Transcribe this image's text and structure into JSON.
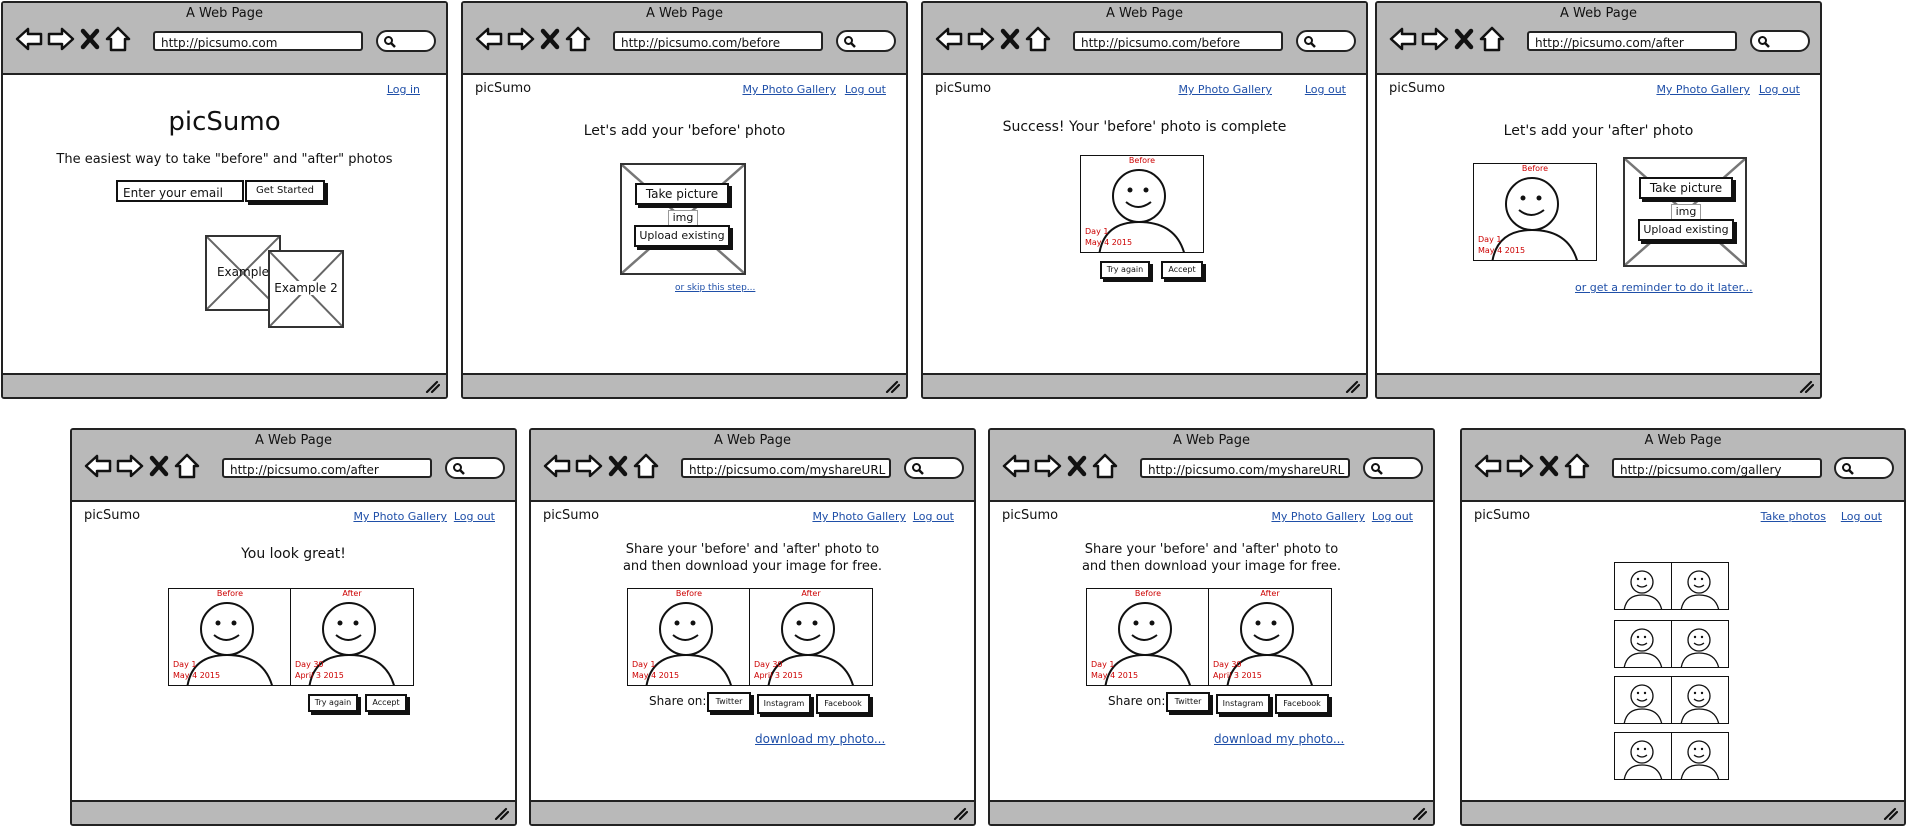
{
  "browser": {
    "title": "A Web Page"
  },
  "site": {
    "logo": "picSumo",
    "gallery_link": "My Photo Gallery",
    "logout_link": "Log out",
    "login_link": "Log in",
    "take_photos_link": "Take photos"
  },
  "photo": {
    "before_tag": "Before",
    "after_tag": "After",
    "before_day": "Day 1",
    "before_date": "May 4 2015",
    "after_day": "Day 30",
    "after_date": "April 3 2015"
  },
  "buttons": {
    "try_again": "Try again",
    "accept": "Accept",
    "take_picture": "Take picture",
    "upload_existing": "Upload existing",
    "img": "img",
    "twitter": "Twitter",
    "instagram": "Instagram",
    "facebook": "Facebook"
  },
  "screens": {
    "s1": {
      "url": "http://picsumo.com",
      "title": "picSumo",
      "tagline": "The easiest way to take \"before\" and \"after\" photos",
      "email_placeholder": "Enter your email",
      "get_started": "Get Started",
      "example1": "Example",
      "example2": "Example 2"
    },
    "s2": {
      "url": "http://picsumo.com/before",
      "heading": "Let's add your 'before' photo",
      "skip": "or skip this step..."
    },
    "s3": {
      "url": "http://picsumo.com/before",
      "heading": "Success! Your 'before' photo is complete"
    },
    "s4": {
      "url": "http://picsumo.com/after",
      "heading": "Let's add your 'after' photo",
      "reminder": "or get a reminder to do it later..."
    },
    "s5": {
      "url": "http://picsumo.com/after",
      "heading": "You look great!"
    },
    "s6": {
      "url": "http://picsumo.com/myshareURL",
      "heading_line1": "Share your 'before' and 'after' photo to",
      "heading_line2": "and then download your image for free.",
      "share_on": "Share on:",
      "download": "download my photo..."
    },
    "s7": {
      "url": "http://picsumo.com/myshareURL",
      "heading_line1": "Share your 'before' and 'after' photo to",
      "heading_line2": "and then download your image for free.",
      "share_on": "Share on:",
      "download": "download my photo..."
    },
    "s8": {
      "url": "http://picsumo.com/gallery"
    }
  }
}
